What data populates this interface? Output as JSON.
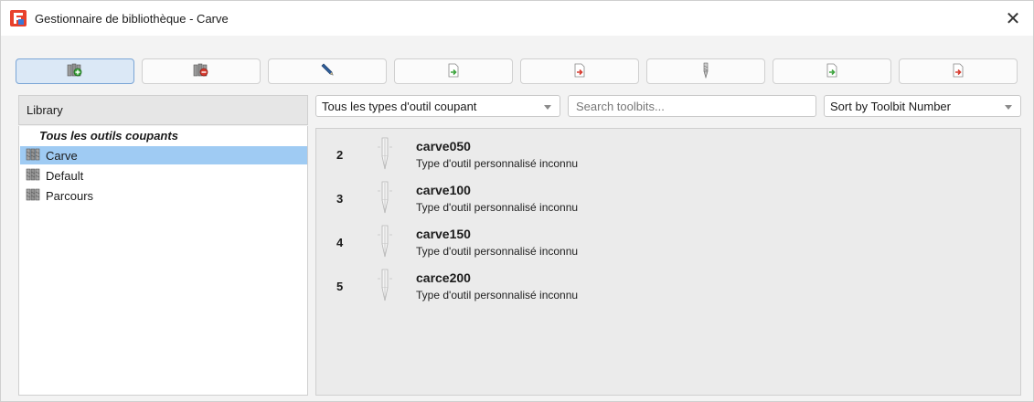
{
  "window": {
    "title": "Gestionnaire de bibliothèque - Carve",
    "close_glyph": "✕",
    "app_icon": "freecad-logo-icon",
    "accent_color": "#e8412c"
  },
  "toolbar": {
    "buttons": [
      {
        "name": "add-library-button",
        "icon": "library-add-icon",
        "active": true
      },
      {
        "name": "remove-library-button",
        "icon": "library-remove-icon",
        "active": false
      },
      {
        "name": "rename-library-button",
        "icon": "pencil-icon",
        "active": false
      },
      {
        "name": "import-library-button",
        "icon": "import-document-icon",
        "active": false
      },
      {
        "name": "export-library-button",
        "icon": "export-document-icon",
        "active": false
      },
      {
        "name": "create-toolbit-button",
        "icon": "toolbit-icon",
        "active": false
      },
      {
        "name": "import-toolbit-button",
        "icon": "import-document-icon",
        "active": false
      },
      {
        "name": "export-toolbit-button",
        "icon": "export-document-icon",
        "active": false
      }
    ]
  },
  "library": {
    "header": "Library",
    "root_label": "Tous les outils coupants",
    "items": [
      {
        "label": "Carve",
        "selected": true
      },
      {
        "label": "Default",
        "selected": false
      },
      {
        "label": "Parcours",
        "selected": false
      }
    ]
  },
  "filters": {
    "type_filter": "Tous les types d'outil coupant",
    "search_placeholder": "Search toolbits...",
    "search_value": "",
    "sort": "Sort by Toolbit Number"
  },
  "tools": [
    {
      "number": "2",
      "name": "carve050",
      "description": "Type d'outil personnalisé inconnu"
    },
    {
      "number": "3",
      "name": "carve100",
      "description": "Type d'outil personnalisé inconnu"
    },
    {
      "number": "4",
      "name": "carve150",
      "description": "Type d'outil personnalisé inconnu"
    },
    {
      "number": "5",
      "name": "carce200",
      "description": "Type d'outil personnalisé inconnu"
    }
  ]
}
